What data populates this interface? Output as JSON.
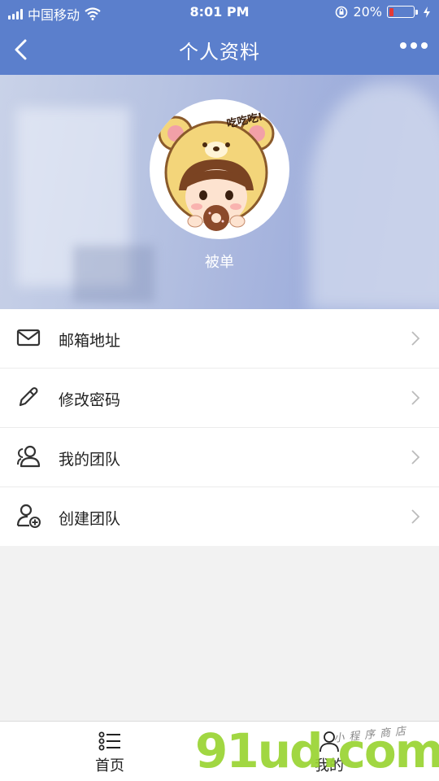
{
  "status_bar": {
    "carrier": "中国移动",
    "time": "8:01 PM",
    "battery_percent": "20%",
    "battery_level": 0.2,
    "icons": [
      "signal-icon",
      "wifi-icon",
      "orientation-lock-icon",
      "battery-icon",
      "charging-icon"
    ]
  },
  "nav": {
    "title": "个人资料",
    "back_icon": "chevron-left-icon",
    "more_icon": "more-dots-icon"
  },
  "profile": {
    "name": "被单",
    "avatar_caption": "吃吃吃!"
  },
  "menu": {
    "items": [
      {
        "label": "邮箱地址",
        "icon": "mail-icon"
      },
      {
        "label": "修改密码",
        "icon": "pencil-icon"
      },
      {
        "label": "我的团队",
        "icon": "team-icon"
      },
      {
        "label": "创建团队",
        "icon": "add-user-icon"
      }
    ]
  },
  "tab_bar": {
    "items": [
      {
        "label": "首页",
        "icon": "list-icon"
      },
      {
        "label": "我的",
        "icon": "user-icon"
      }
    ]
  },
  "watermark": {
    "main": "91ud.com",
    "sub": "小程序商店"
  },
  "colors": {
    "nav_background": "#5b7fcc",
    "battery_low": "#e53935",
    "watermark_green": "#9ad433"
  }
}
